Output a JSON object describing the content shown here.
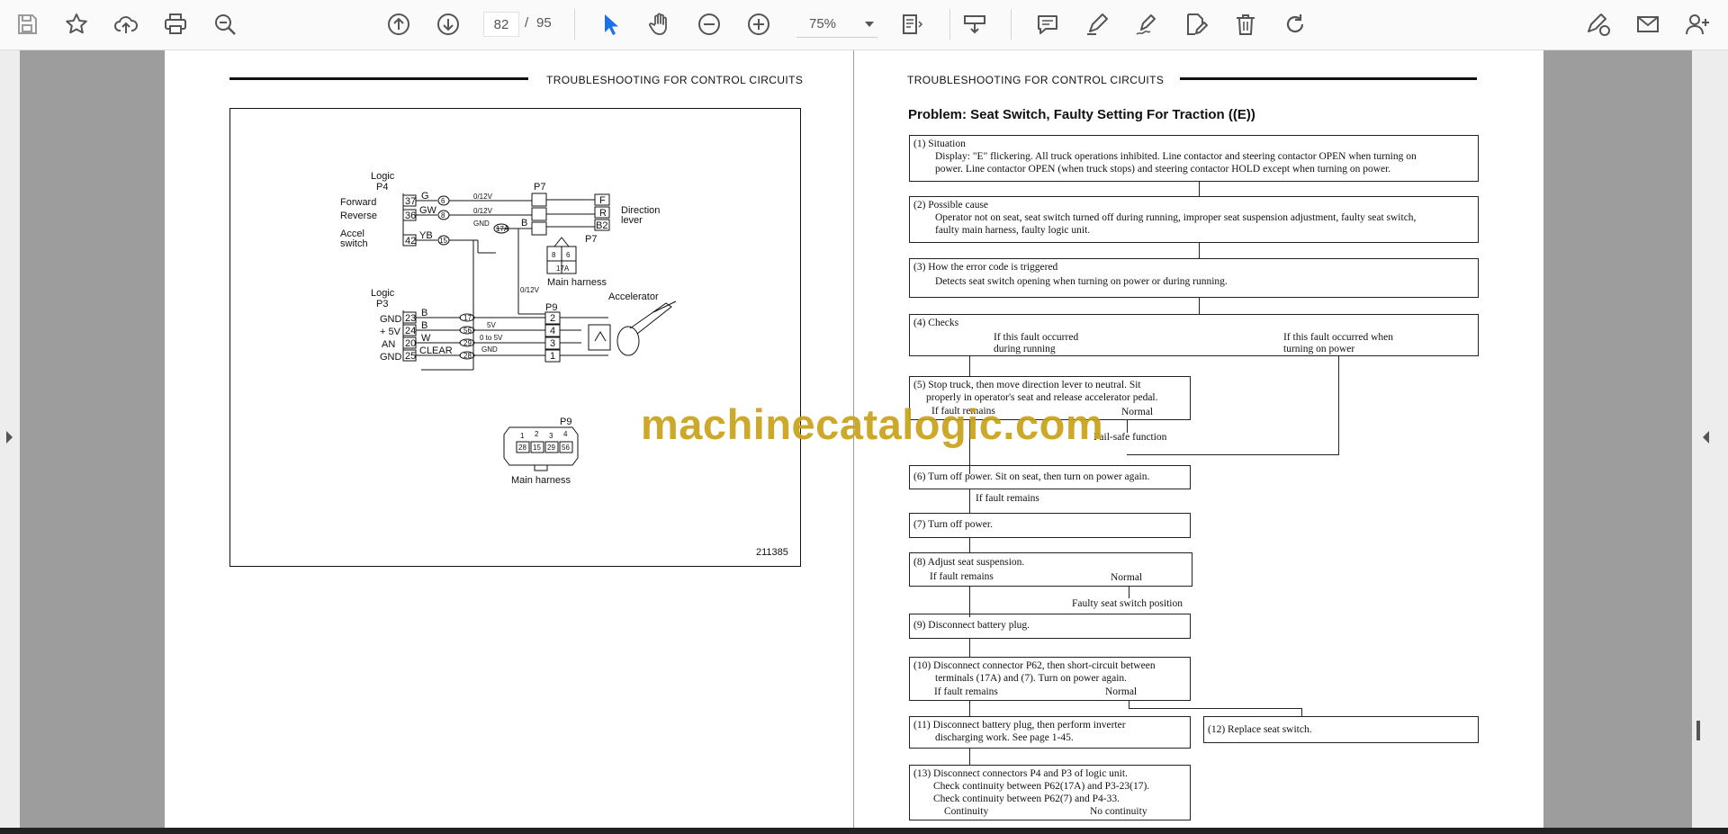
{
  "toolbar": {
    "page_current": "82",
    "page_separator": "/",
    "page_total": "95",
    "zoom": "75%",
    "icons": [
      "save-icon",
      "bookmark-star-icon",
      "upload-cloud-icon",
      "print-icon",
      "find-zoom-icon",
      "page-up-icon",
      "page-down-icon",
      "select-cursor-icon",
      "hand-pan-icon",
      "zoom-out-icon",
      "zoom-in-icon",
      "fit-page-icon",
      "marquee-icon",
      "comment-icon",
      "highlight-pen-icon",
      "sign-pen-icon",
      "edit-doc-icon",
      "delete-icon",
      "rotate-icon",
      "sign-request-icon",
      "email-icon",
      "add-user-icon"
    ],
    "accent_color": "#1a73e8"
  },
  "watermark": "machinecatalogic.com",
  "left_page": {
    "header": "TROUBLESHOOTING FOR CONTROL CIRCUITS",
    "diagram": {
      "figure_number": "211385",
      "labels": {
        "logic_p4_line1": "Logic",
        "logic_p4_line2": "P4",
        "forward": "Forward",
        "reverse": "Reverse",
        "accel_line1": "Accel",
        "accel_line2": "switch",
        "pin37": "37",
        "pin36": "36",
        "pin42": "42",
        "wire_g": "G",
        "wire_gw": "GW",
        "wire_yb": "YB",
        "circ6": "6",
        "circ8": "8",
        "circ15": "15",
        "volt1": "0/12V",
        "volt2": "0/12V",
        "gnd1": "GND",
        "circ17a": "17A",
        "p7": "P7",
        "p7_b": "B",
        "sw_f": "F",
        "sw_r": "R",
        "sw_b2": "B2",
        "direction_line1": "Direction",
        "direction_line2": "lever",
        "p7_connector": "P7",
        "conn_8": "8",
        "conn_6": "6",
        "conn_17a": "17A",
        "main_harness_1": "Main harness",
        "volt3": "0/12V",
        "logic_p3_line1": "Logic",
        "logic_p3_line2": "P3",
        "gnd_a": "GND",
        "plus5v": "+ 5V",
        "an": "AN",
        "gnd_b": "GND",
        "pin23": "23",
        "pin24": "24",
        "pin20": "20",
        "pin25": "25",
        "wire_b1": "B",
        "wire_b2": "B",
        "wire_w": "W",
        "wire_clear": "CLEAR",
        "c17": "17",
        "c56": "56",
        "c29": "29",
        "c28": "28",
        "v5": "5V",
        "v0to5": "0 to 5V",
        "gnd2": "GND",
        "p9": "P9",
        "p9_2": "2",
        "p9_4": "4",
        "p9_3": "3",
        "p9_1": "1",
        "accelerator": "Accelerator",
        "p9_connector": "P9",
        "pin_1": "1",
        "pin_2": "2",
        "pin_3": "3",
        "pin_4": "4",
        "pc28": "28",
        "pc15": "15",
        "pc29": "29",
        "pc56": "56",
        "main_harness_2": "Main harness"
      }
    }
  },
  "right_page": {
    "header": "TROUBLESHOOTING FOR CONTROL CIRCUITS",
    "title": "Problem: Seat Switch, Faulty Setting For Traction ((E))",
    "steps": {
      "s1_title": "(1) Situation",
      "s1_line1": "Display: \"E\" flickering. All truck operations inhibited. Line contactor and steering contactor OPEN when turning on",
      "s1_line2": "power. Line contactor OPEN (when truck stops) and steering contactor HOLD except when turning on power.",
      "s2_title": "(2) Possible cause",
      "s2_line1": "Operator not on seat, seat switch turned off during running, improper seat suspension adjustment, faulty seat switch,",
      "s2_line2": "faulty main harness, faulty logic unit.",
      "s3_title": "(3) How the error code is triggered",
      "s3_line1": "Detects seat switch opening when turning on power or during running.",
      "s4_title": "(4) Checks",
      "s4_left1": "If this fault occurred",
      "s4_left2": "during running",
      "s4_right1": "If this fault occurred when",
      "s4_right2": "turning on power",
      "s5_line1": "(5) Stop truck, then move direction lever to neutral. Sit",
      "s5_line2": "properly in operator's seat and release accelerator pedal.",
      "s5_fault": "If fault remains",
      "s5_normal": "Normal",
      "failsafe": "Fail-safe function",
      "s6": "(6) Turn off power. Sit on seat, then turn on power again.",
      "s6_fault": "If fault remains",
      "s7": "(7) Turn off power.",
      "s8": "(8) Adjust seat suspension.",
      "s8_fault": "If fault remains",
      "s8_normal": "Normal",
      "faulty_seat": "Faulty seat switch position",
      "s9": "(9) Disconnect battery plug.",
      "s10_line1": "(10) Disconnect connector P62, then short-circuit between",
      "s10_line2": "terminals (17A) and (7). Turn on power again.",
      "s10_fault": "If fault remains",
      "s10_normal": "Normal",
      "s11_line1": "(11) Disconnect battery plug, then perform inverter",
      "s11_line2": "discharging work. See page 1-45.",
      "s12": "(12) Replace seat switch.",
      "s13_line1": "(13) Disconnect connectors P4 and P3 of logic unit.",
      "s13_line2": "Check continuity between P62(17A) and P3-23(17).",
      "s13_line3": "Check continuity between P62(7) and P4-33.",
      "s13_cont": "Continuity",
      "s13_nocont": "No continuity"
    }
  }
}
